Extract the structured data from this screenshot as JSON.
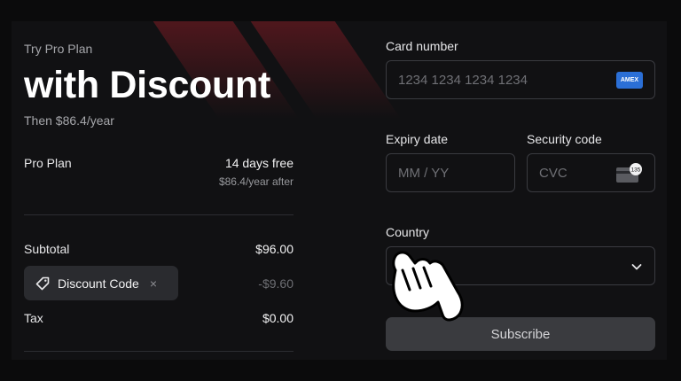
{
  "summary": {
    "eyebrow": "Try Pro Plan",
    "headline": "with Discount",
    "then_price": "Then $86.4/year",
    "plan_name": "Pro Plan",
    "plan_trial": "14 days free",
    "plan_after": "$86.4/year after",
    "subtotal_label": "Subtotal",
    "subtotal_value": "$96.00",
    "discount_code_label": "Discount Code",
    "discount_remove": "×",
    "discount_value": "-$9.60",
    "tax_label": "Tax",
    "tax_value": "$0.00"
  },
  "form": {
    "card_number_label": "Card number",
    "card_number_placeholder": "1234 1234 1234 1234",
    "card_brand": "AMEX",
    "expiry_label": "Expiry date",
    "expiry_placeholder": "MM / YY",
    "security_label": "Security code",
    "security_placeholder": "CVC",
    "cvc_icon_text": "135",
    "country_label": "Country",
    "country_value": "",
    "subscribe_label": "Subscribe"
  },
  "icons": {
    "tag": "tag-icon",
    "remove": "close-icon",
    "card_brand": "amex-card-icon",
    "cvc": "cvc-card-icon",
    "chevron": "chevron-down-icon",
    "cursor": "hand-pointer-cursor-icon"
  },
  "colors": {
    "background": "#0b0b0c",
    "panel": "#111113",
    "accent_glow": "#961e28",
    "amex_blue": "#2b6fd6",
    "button": "#3a3b3f"
  }
}
